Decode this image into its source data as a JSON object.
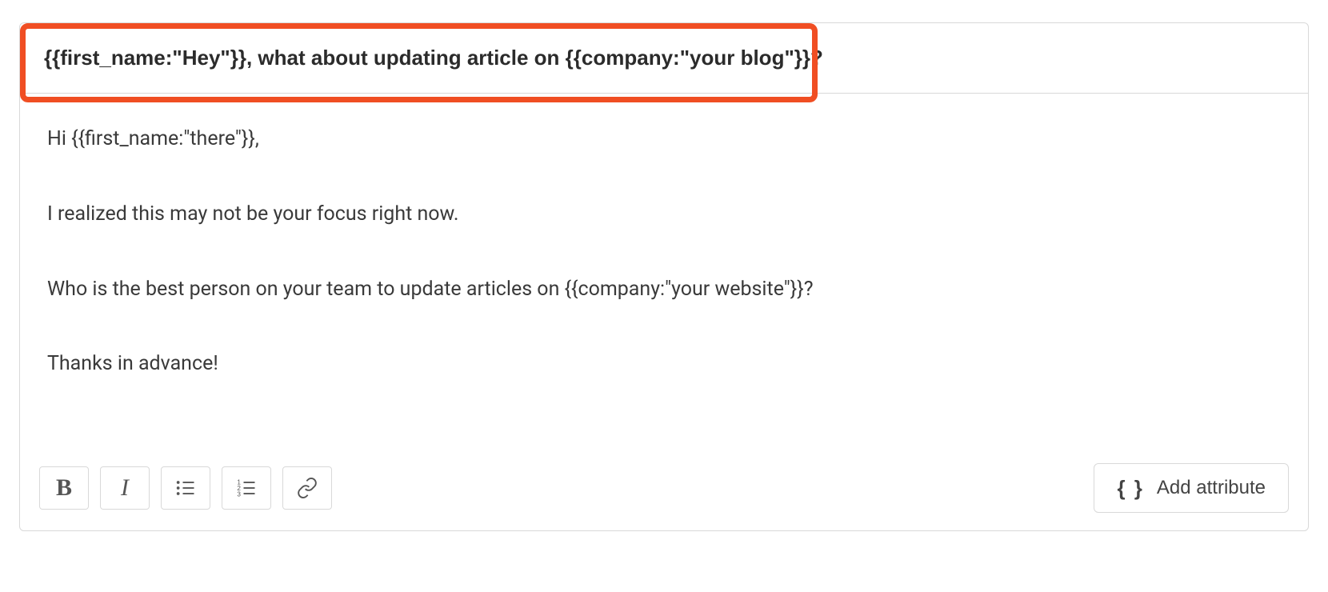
{
  "subject": "{{first_name:\"Hey\"}}, what about updating article on {{company:\"your blog\"}}?",
  "body": {
    "p1": "Hi {{first_name:\"there\"}},",
    "p2": "I realized this may not be your focus right now.",
    "p3": "Who is the best person on your team to update articles on {{company:\"your website\"}}?",
    "p4": "Thanks in advance!"
  },
  "toolbar": {
    "bold_label": "B",
    "italic_label": "I",
    "add_attribute_label": "Add attribute",
    "braces_glyph": "{ }"
  },
  "highlight_color": "#f04e23"
}
